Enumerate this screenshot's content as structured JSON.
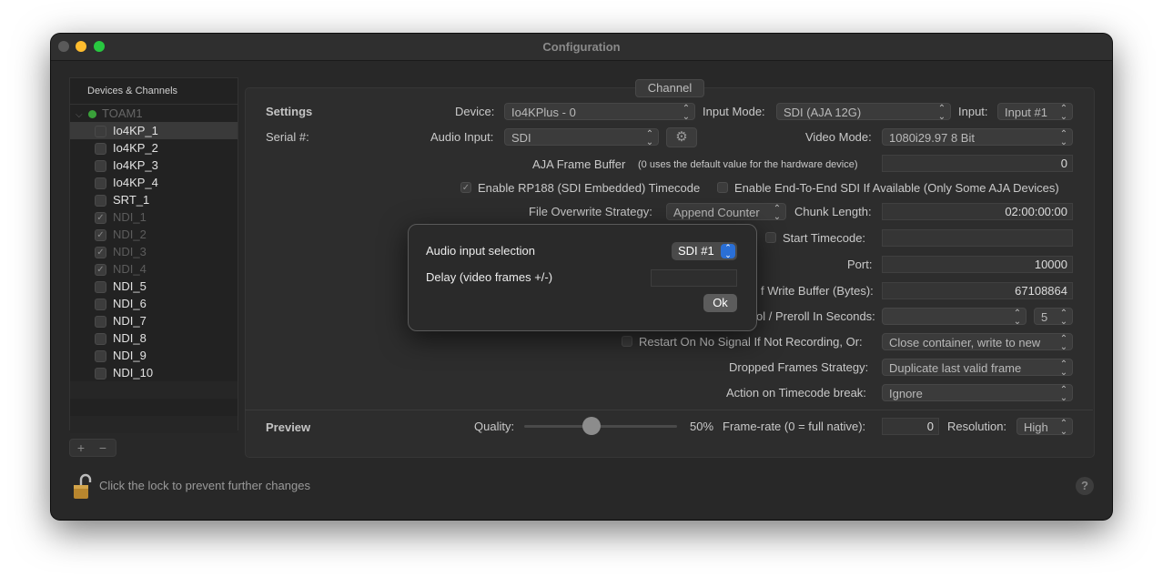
{
  "window": {
    "title": "Configuration"
  },
  "sidebar": {
    "header": "Devices & Channels",
    "group": {
      "name": "TOAM1",
      "status_color": "#3aa13a"
    },
    "items": [
      {
        "label": "Io4KP_1",
        "checked": false,
        "dim": false,
        "selected": true
      },
      {
        "label": "Io4KP_2",
        "checked": false,
        "dim": false
      },
      {
        "label": "Io4KP_3",
        "checked": false,
        "dim": false
      },
      {
        "label": "Io4KP_4",
        "checked": false,
        "dim": false
      },
      {
        "label": "SRT_1",
        "checked": false,
        "dim": false
      },
      {
        "label": "NDI_1",
        "checked": true,
        "dim": true
      },
      {
        "label": "NDI_2",
        "checked": true,
        "dim": true
      },
      {
        "label": "NDI_3",
        "checked": true,
        "dim": true
      },
      {
        "label": "NDI_4",
        "checked": true,
        "dim": true
      },
      {
        "label": "NDI_5",
        "checked": false,
        "dim": false
      },
      {
        "label": "NDI_6",
        "checked": false,
        "dim": false
      },
      {
        "label": "NDI_7",
        "checked": false,
        "dim": false
      },
      {
        "label": "NDI_8",
        "checked": false,
        "dim": false
      },
      {
        "label": "NDI_9",
        "checked": false,
        "dim": false
      },
      {
        "label": "NDI_10",
        "checked": false,
        "dim": false
      }
    ],
    "add_label": "+",
    "remove_label": "−"
  },
  "channel_tab": "Channel",
  "settings": {
    "section_title": "Settings",
    "serial_label": "Serial #:",
    "device_label": "Device:",
    "device_value": "Io4KPlus - 0",
    "input_mode_label": "Input Mode:",
    "input_mode_value": "SDI (AJA 12G)",
    "input_label": "Input:",
    "input_value": "Input #1",
    "audio_input_label": "Audio Input:",
    "audio_input_value": "SDI",
    "video_mode_label": "Video Mode:",
    "video_mode_value": "1080i29.97 8 Bit",
    "frame_buffer_label": "AJA Frame Buffer",
    "frame_buffer_hint": "(0 uses the default value for the hardware device)",
    "frame_buffer_value": "0",
    "rp188_label": "Enable RP188 (SDI Embedded) Timecode",
    "rp188_checked": true,
    "e2e_label": "Enable End-To-End SDI If Available (Only Some AJA Devices)",
    "e2e_checked": false,
    "overwrite_label": "File Overwrite Strategy:",
    "overwrite_value": "Append Counter",
    "chunk_label": "Chunk Length:",
    "chunk_value": "02:00:00:00",
    "start_tc_label": "Start Timecode:",
    "start_tc_value": "",
    "port_label": "Port:",
    "port_value": "10000",
    "write_buffer_label": "f Write Buffer (Bytes):",
    "write_buffer_value": "67108864",
    "preroll_label": "ol / Preroll In Seconds:",
    "preroll_value": "",
    "preroll_count": "5",
    "restart_label": "Restart On No Signal If Not Recording, Or:",
    "restart_checked": false,
    "restart_value": "Close container, write to new",
    "dropped_label": "Dropped Frames Strategy:",
    "dropped_value": "Duplicate last valid frame",
    "tc_break_label": "Action on Timecode break:",
    "tc_break_value": "Ignore"
  },
  "preview": {
    "section_title": "Preview",
    "quality_label": "Quality:",
    "quality_value": "50%",
    "quality_fraction": 0.5,
    "framerate_label": "Frame-rate (0 = full native):",
    "framerate_value": "0",
    "resolution_label": "Resolution:",
    "resolution_value": "High"
  },
  "footer": {
    "lock_text": "Click the lock to prevent further changes",
    "help_label": "?"
  },
  "dialog": {
    "audio_label": "Audio input selection",
    "audio_value": "SDI #1",
    "delay_label": "Delay (video frames +/-)",
    "delay_value": "",
    "ok_label": "Ok",
    "accent": "#2a6fd6"
  }
}
